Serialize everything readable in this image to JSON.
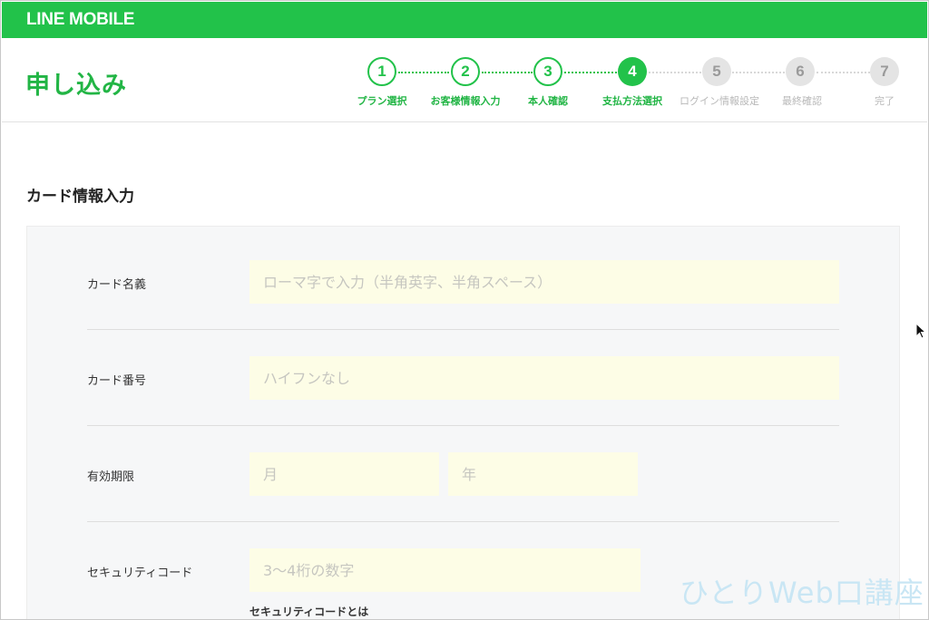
{
  "brand": {
    "logo": "LINE MOBILE",
    "accent": "#22c24a"
  },
  "header": {
    "title": "申し込み"
  },
  "steps": [
    {
      "number": "1",
      "label": "プラン選択",
      "state": "done"
    },
    {
      "number": "2",
      "label": "お客様情報入力",
      "state": "done"
    },
    {
      "number": "3",
      "label": "本人確認",
      "state": "done"
    },
    {
      "number": "4",
      "label": "支払方法選択",
      "state": "current"
    },
    {
      "number": "5",
      "label": "ログイン情報設定",
      "state": "todo"
    },
    {
      "number": "6",
      "label": "最終確認",
      "state": "todo"
    },
    {
      "number": "7",
      "label": "完了",
      "state": "todo"
    }
  ],
  "form": {
    "section_title": "カード情報入力",
    "card_name": {
      "label": "カード名義",
      "placeholder": "ローマ字で入力（半角英字、半角スペース）",
      "value": ""
    },
    "card_number": {
      "label": "カード番号",
      "placeholder": "ハイフンなし",
      "value": ""
    },
    "expiry": {
      "label": "有効期限",
      "month_placeholder": "月",
      "year_placeholder": "年"
    },
    "security_code": {
      "label": "セキュリティコード",
      "placeholder": "3〜4桁の数字",
      "help_link": "セキュリティコードとは"
    }
  },
  "watermark": "ひとりWeb口講座"
}
